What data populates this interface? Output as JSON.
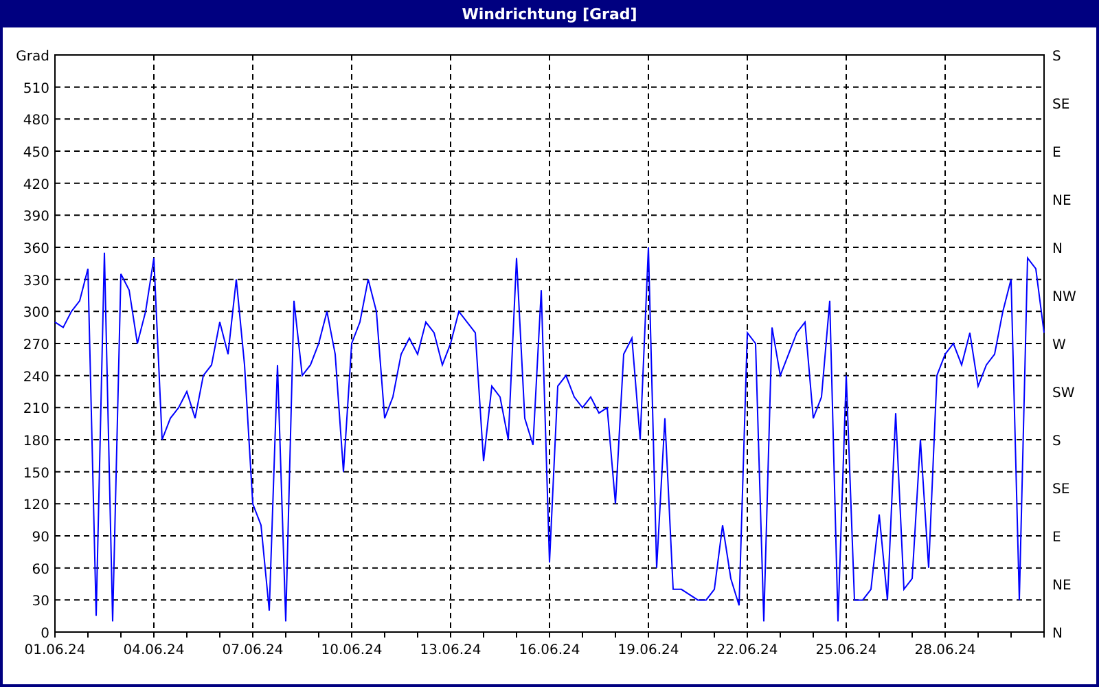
{
  "window": {
    "title": "Windrichtung [Grad]"
  },
  "chart_data": {
    "type": "line",
    "ylabel": "Grad",
    "categories": [
      "01.06.24",
      null,
      null,
      null,
      null,
      null,
      null,
      null,
      null,
      null,
      null,
      null,
      "04.06.24",
      null,
      null,
      null,
      null,
      null,
      null,
      null,
      null,
      null,
      null,
      null,
      "07.06.24",
      null,
      null,
      null,
      null,
      null,
      null,
      null,
      null,
      null,
      null,
      null,
      "10.06.24",
      null,
      null,
      null,
      null,
      null,
      null,
      null,
      null,
      null,
      null,
      null,
      "13.06.24",
      null,
      null,
      null,
      null,
      null,
      null,
      null,
      null,
      null,
      null,
      null,
      "16.06.24",
      null,
      null,
      null,
      null,
      null,
      null,
      null,
      null,
      null,
      null,
      null,
      "19.06.24",
      null,
      null,
      null,
      null,
      null,
      null,
      null,
      null,
      null,
      null,
      null,
      "22.06.24",
      null,
      null,
      null,
      null,
      null,
      null,
      null,
      null,
      null,
      null,
      null,
      "25.06.24",
      null,
      null,
      null,
      null,
      null,
      null,
      null,
      null,
      null,
      null,
      null,
      "28.06.24",
      null,
      null,
      null,
      null,
      null,
      null,
      null,
      null,
      null,
      null,
      null,
      null
    ],
    "series": [
      {
        "color": "#0000ff",
        "values": [
          290,
          285,
          300,
          310,
          340,
          15,
          355,
          10,
          335,
          320,
          270,
          300,
          350,
          180,
          200,
          210,
          225,
          200,
          240,
          250,
          290,
          260,
          330,
          250,
          120,
          100,
          20,
          250,
          10,
          310,
          240,
          250,
          270,
          300,
          260,
          150,
          270,
          290,
          330,
          300,
          200,
          220,
          260,
          275,
          260,
          290,
          280,
          250,
          270,
          300,
          290,
          280,
          160,
          230,
          220,
          180,
          350,
          200,
          175,
          320,
          65,
          230,
          240,
          220,
          210,
          220,
          205,
          210,
          120,
          260,
          275,
          180,
          360,
          60,
          200,
          40,
          40,
          35,
          30,
          30,
          40,
          100,
          50,
          25,
          280,
          270,
          10,
          285,
          240,
          260,
          280,
          290,
          200,
          220,
          310,
          10,
          240,
          30,
          30,
          40,
          110,
          30,
          205,
          40,
          50,
          180,
          60,
          240,
          260,
          270,
          250,
          280,
          230,
          250,
          260,
          300,
          330,
          30,
          350,
          340,
          280
        ]
      }
    ],
    "ylim": [
      0,
      540
    ],
    "grid": true,
    "yticks": [
      0,
      30,
      60,
      90,
      120,
      150,
      180,
      210,
      240,
      270,
      300,
      330,
      360,
      390,
      420,
      450,
      480,
      510
    ]
  },
  "right_axis": [
    {
      "label": "S"
    },
    {
      "label": "SE"
    },
    {
      "label": "E"
    },
    {
      "label": "NE"
    },
    {
      "label": "N"
    },
    {
      "label": "NW"
    },
    {
      "label": "W"
    },
    {
      "label": "SW"
    },
    {
      "label": "S"
    },
    {
      "label": "SE"
    },
    {
      "label": "E"
    },
    {
      "label": "NE"
    },
    {
      "label": "N"
    }
  ]
}
